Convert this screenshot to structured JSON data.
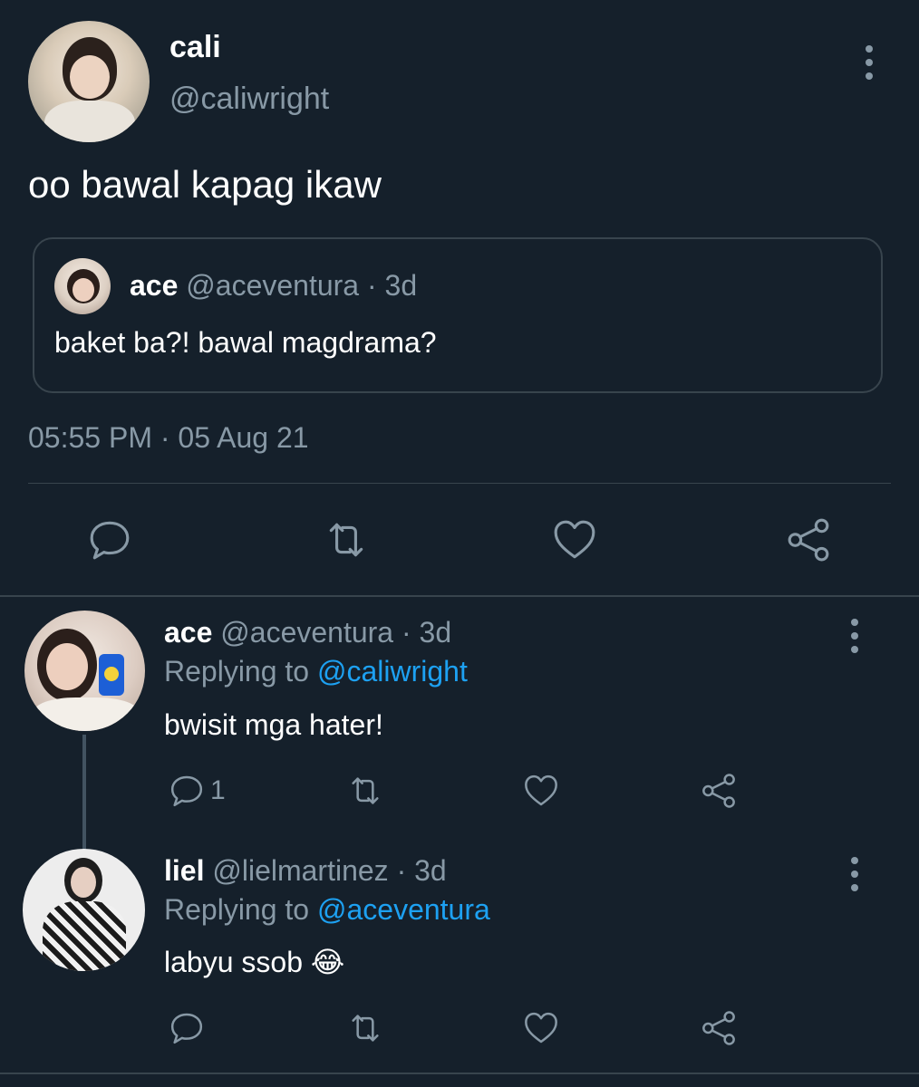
{
  "main_tweet": {
    "display_name": "cali",
    "handle": "@caliwright",
    "text": "oo bawal kapag ikaw",
    "timestamp": "05:55 PM · 05 Aug 21",
    "quoted": {
      "display_name": "ace",
      "handle_time": "@aceventura · 3d",
      "text": "baket ba?! bawal magdrama?"
    }
  },
  "replies": [
    {
      "display_name": "ace",
      "handle_time": "@aceventura · 3d",
      "replying_prefix": "Replying to",
      "replying_to": "@caliwright",
      "text": "bwisit mga hater!",
      "reply_count": "1"
    },
    {
      "display_name": "liel",
      "handle_time": "@lielmartinez · 3d",
      "replying_prefix": "Replying to",
      "replying_to": "@aceventura",
      "text": "labyu ssob",
      "emoji": "😂"
    }
  ],
  "icons": {
    "reply": "reply-icon",
    "retweet": "retweet-icon",
    "like": "heart-icon",
    "share": "share-icon",
    "more": "more-options-icon"
  },
  "colors": {
    "background": "#15202b",
    "muted": "#8899a6",
    "link": "#1da1f2",
    "divider": "#38444d"
  }
}
